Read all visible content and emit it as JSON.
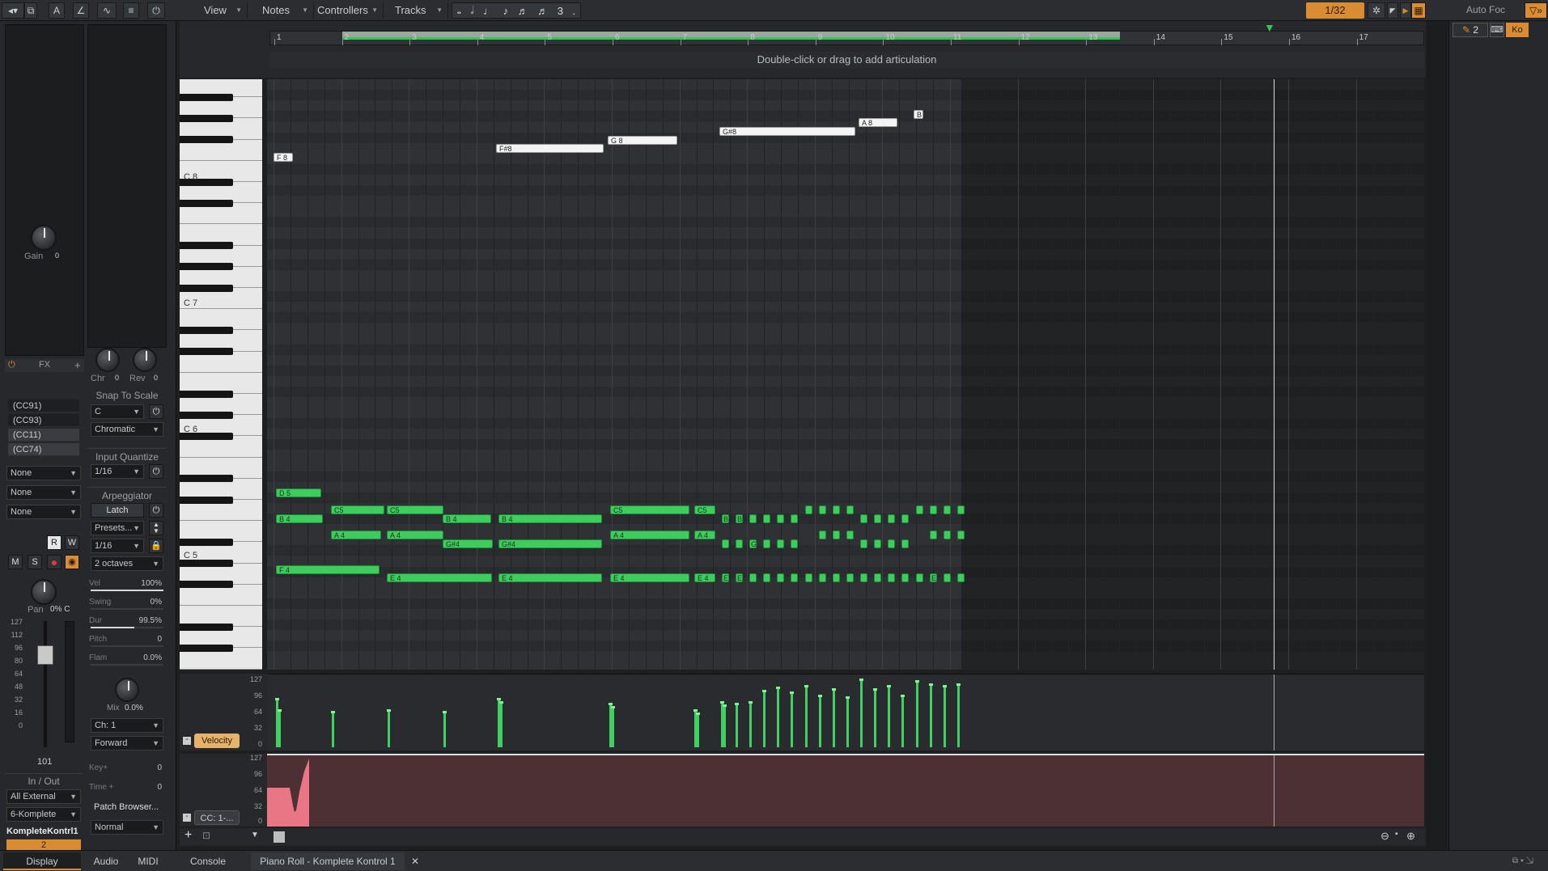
{
  "toolbar": {
    "menus": [
      "View",
      "Notes",
      "Controllers",
      "Tracks"
    ],
    "snap_value": "1/32",
    "auto_focus_label": "Auto Foc",
    "note_glyphs": [
      "𝅝",
      "𝅗𝅥",
      "♩",
      "♪",
      "♬",
      "♬",
      "3",
      "."
    ]
  },
  "inspector": {
    "gain_label": "Gain",
    "gain_value": "0",
    "fx_label": "FX",
    "cc_items": [
      "(CC91)",
      "(CC93)",
      "(CC11)",
      "(CC74)"
    ],
    "none_dd": [
      "None",
      "None",
      "None"
    ],
    "chr_label": "Chr",
    "chr_value": "0",
    "rev_label": "Rev",
    "rev_value": "0",
    "snap_to_scale": "Snap To Scale",
    "scale_key": "C",
    "scale_type": "Chromatic",
    "input_quantize": "Input Quantize",
    "iq_value": "1/16",
    "arpeggiator": "Arpeggiator",
    "latch": "Latch",
    "presets": "Presets...",
    "arp_rate": "1/16",
    "arp_range": "2 octaves",
    "params": [
      {
        "label": "Vel",
        "value": "100%",
        "fill": 1.0
      },
      {
        "label": "Swing",
        "value": "0%",
        "fill": 0.0
      },
      {
        "label": "Dur",
        "value": "99.5%",
        "fill": 0.6
      },
      {
        "label": "Pitch",
        "value": "0",
        "fill": 0.0
      },
      {
        "label": "Flam",
        "value": "0.0%",
        "fill": 0.0
      }
    ],
    "mix_label": "Mix",
    "mix_value": "0.0%",
    "channel": "Ch: 1",
    "direction": "Forward",
    "key_plus": "Key+",
    "key_plus_value": "0",
    "time_plus": "Time +",
    "time_plus_value": "0",
    "patch_browser": "Patch Browser...",
    "normal": "Normal",
    "r_btn": "R",
    "w_btn": "W",
    "m_btn": "M",
    "s_btn": "S",
    "pan_label": "Pan",
    "pan_value": "0% C",
    "fader_scale": [
      "127",
      "112",
      "96",
      "80",
      "64",
      "48",
      "32",
      "16",
      "0"
    ],
    "fader_value": "101",
    "in_out": "In / Out",
    "input": "All External",
    "output": "6-Komplete",
    "track_name": "KompleteKontrl1",
    "track_number": "2"
  },
  "ruler": {
    "marks": [
      "1",
      "2",
      "3",
      "4",
      "5",
      "6",
      "7",
      "8",
      "9",
      "10",
      "11",
      "12",
      "13",
      "14",
      "15",
      "16",
      "17"
    ]
  },
  "articulation_hint": "Double-click or drag to add articulation",
  "keyboard": {
    "c_labels": [
      "C 8",
      "C 7",
      "C 6",
      "C 5"
    ]
  },
  "velocity_lane": {
    "label": "Velocity",
    "scale": [
      "127",
      "96",
      "64",
      "32",
      "0"
    ]
  },
  "cc_lane": {
    "label": "CC: 1-...",
    "scale": [
      "127",
      "96",
      "64",
      "32",
      "0"
    ]
  },
  "right_panel": {
    "tool_count": "2",
    "ko_label": "Ko"
  },
  "bottom_tabs": {
    "display": "Display",
    "audio": "Audio",
    "midi": "MIDI",
    "console": "Console",
    "piano_roll": "Piano Roll - Komplete Kontrol 1"
  },
  "colors": {
    "accent": "#d98c32",
    "note": "#3fcc5f",
    "loop": "#37c35a",
    "cc_lane": "#4d3034"
  }
}
